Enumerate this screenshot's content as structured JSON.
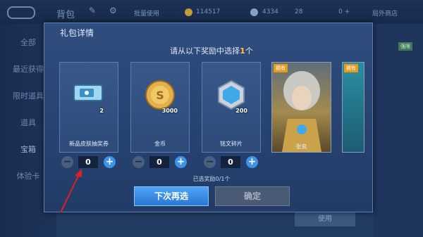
{
  "topbar": {
    "title": "背包",
    "tab_label": "批量使用",
    "currency1": "114517",
    "currency2": "4334",
    "currency3": "28",
    "currency4": "0 +",
    "right_label": "局外商店"
  },
  "sidebar": {
    "items": [
      "全部",
      "最近获得",
      "限时道具",
      "道具",
      "宝箱",
      "体验卡"
    ]
  },
  "background": {
    "use_label": "使用",
    "right_tag": "强限"
  },
  "dialog": {
    "title": "礼包详情",
    "prompt_prefix": "请从以下奖励中选择",
    "prompt_count": "1",
    "prompt_suffix": "个",
    "selected_info": "已选奖励0/1个",
    "next_button": "下次再选",
    "confirm_button": "确定",
    "owned_badge": "拥有",
    "rewards": [
      {
        "label": "新品皮肤抽奖券",
        "qty": "2",
        "value": "0",
        "icon": "ticket-icon"
      },
      {
        "label": "金币",
        "qty": "3000",
        "value": "0",
        "icon": "gold-coin-icon"
      },
      {
        "label": "铭文碎片",
        "qty": "200",
        "value": "0",
        "icon": "inscription-shard-icon"
      }
    ],
    "heroes": [
      {
        "label": "张良",
        "icon": "hero-portrait-icon"
      }
    ]
  },
  "colors": {
    "accent": "#3d93e8",
    "highlight": "#ffc53d",
    "owned": "#e59b1e"
  }
}
